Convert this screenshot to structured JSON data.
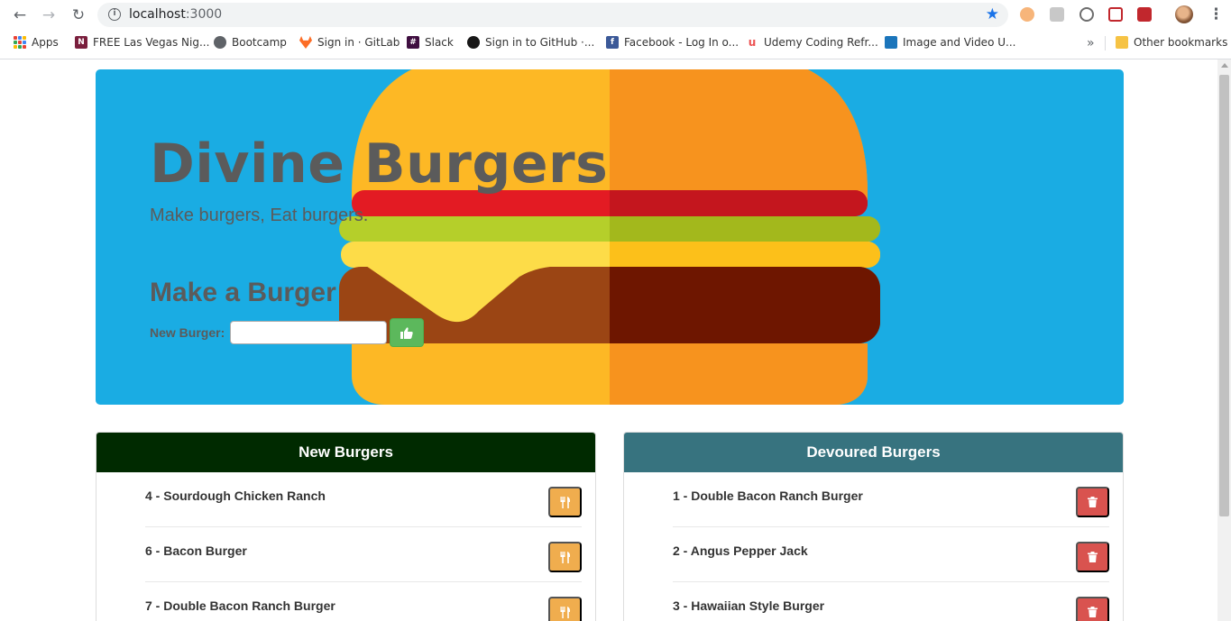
{
  "browser": {
    "url_host": "localhost",
    "url_port": ":3000",
    "bookmarks": [
      {
        "label": "Apps",
        "icon": "apps-grid-icon"
      },
      {
        "label": "FREE Las Vegas Nig...",
        "icon": "nbc-favicon"
      },
      {
        "label": "Bootcamp",
        "icon": "globe-favicon"
      },
      {
        "label": "Sign in · GitLab",
        "icon": "gitlab-favicon"
      },
      {
        "label": "Slack",
        "icon": "slack-favicon"
      },
      {
        "label": "Sign in to GitHub ·...",
        "icon": "github-favicon"
      },
      {
        "label": "Facebook - Log In o...",
        "icon": "facebook-favicon"
      },
      {
        "label": "Udemy Coding Refr...",
        "icon": "udemy-favicon"
      },
      {
        "label": "Image and Video U...",
        "icon": "image-upload-favicon"
      }
    ],
    "overflow_label": "»",
    "other_bookmarks": "Other bookmarks"
  },
  "jumbotron": {
    "title": "Divine Burgers",
    "subtitle": "Make burgers, Eat burgers.",
    "form_heading": "Make a Burger",
    "input_label": "New Burger:",
    "input_value": "",
    "submit_icon": "thumbs-up-icon"
  },
  "new_burgers": {
    "heading": "New Burgers",
    "header_color": "#002a00",
    "button_color": "#f0ad4e",
    "button_icon": "cutlery-icon",
    "items": [
      {
        "label": "4 - Sourdough Chicken Ranch"
      },
      {
        "label": "6 - Bacon Burger"
      },
      {
        "label": "7 - Double Bacon Ranch Burger"
      }
    ]
  },
  "devoured_burgers": {
    "heading": "Devoured Burgers",
    "header_color": "#37737f",
    "button_color": "#d9534f",
    "button_icon": "trash-icon",
    "items": [
      {
        "label": "1 - Double Bacon Ranch Burger"
      },
      {
        "label": "2 - Angus Pepper Jack"
      },
      {
        "label": "3 - Hawaiian Style Burger"
      }
    ]
  }
}
